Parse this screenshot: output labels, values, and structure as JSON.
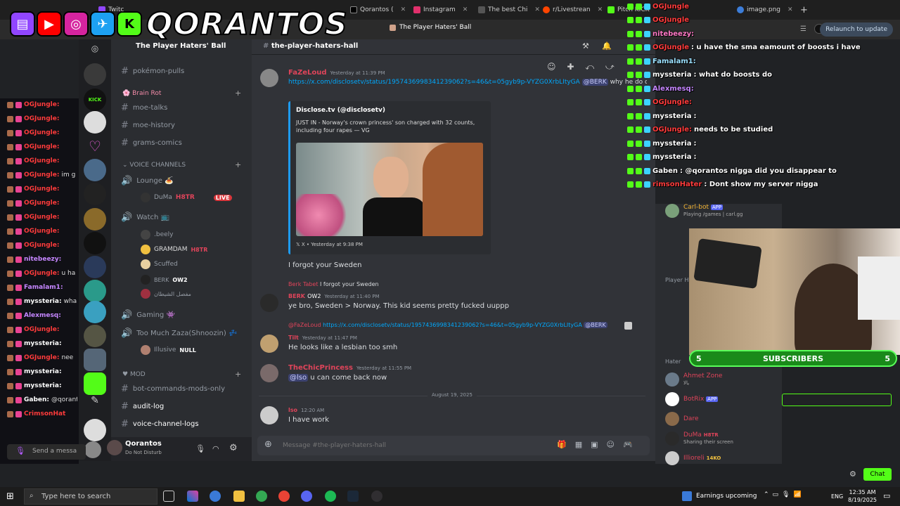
{
  "browser": {
    "tabs": [
      {
        "label": "Twitc",
        "color": "#9146ff"
      },
      {
        "label": "Qorantos (",
        "color": "#000000"
      },
      {
        "label": "Instagram",
        "color": "#e1306c"
      },
      {
        "label": "The best Chi",
        "color": "#444444"
      },
      {
        "label": "r/Livestrean",
        "color": "#ff4500"
      },
      {
        "label": "Pitch KICK",
        "color": "#53fc18"
      },
      {
        "label": "image.png",
        "color": "#3c7dd9"
      }
    ],
    "window_title": "The Player Haters' Ball",
    "relaunch_label": "Relaunch to update"
  },
  "overlay": {
    "brand": "QORANTOS"
  },
  "discord": {
    "server_name": "The Player Haters' Ball",
    "channel_name": "the-player-haters-hall",
    "channels_top": [
      "pokémon-pulls"
    ],
    "category_brainrot": "Brain Rot",
    "channels_brainrot": [
      "moe-talks",
      "moe-history",
      "grams-comics"
    ],
    "category_voice": "VOICE CHANNELS",
    "voice": [
      {
        "name": "Lounge 🍝",
        "users": [
          {
            "name": "DuMa",
            "tag": "H8TR",
            "live": "LIVE"
          }
        ]
      },
      {
        "name": "Watch 📺",
        "users": [
          {
            "name": ".beely"
          },
          {
            "name": "GRAMDAM",
            "tag": "H8TR"
          },
          {
            "name": "Scuffed"
          },
          {
            "name": "BERK",
            "tag": "OW2"
          },
          {
            "name": "مفصل الشيطان"
          }
        ]
      },
      {
        "name": "Gaming 👾",
        "users": []
      },
      {
        "name": "Too Much Zaza(Shnoozin) 💤",
        "users": [
          {
            "name": "Illusive",
            "tag": "NULL"
          }
        ]
      }
    ],
    "category_mod": "MOD",
    "channels_mod": [
      "bot-commands-mods-only",
      "audit-log",
      "voice-channel-logs"
    ],
    "self": {
      "name": "Qorantos",
      "status": "Do Not Disturb"
    },
    "messages": {
      "m1_name": "FaZeLoud",
      "m1_time": "Yesterday at 11:39 PM",
      "m1_link": "https://x.com/disclosetv/status/1957436998341239062?s=46&t=05gyb9p-VYZG0XrbLItyGA",
      "m1_mention": "@BERK",
      "m1_tail": "why he do dat",
      "embed_author": "Disclose.tv (@disclosetv)",
      "embed_text_1": "JUST IN - Norway's crown princess' son charged with 32 counts,",
      "embed_text_2": "including four rapes — VG",
      "embed_footer": "X • Yesterday at 9:38 PM",
      "m1_followup": "I forgot your Sweden",
      "m2_reply_name": "Berk Tabet",
      "m2_reply_text": "I forgot your Sweden",
      "m2_name": "BERK",
      "m2_tag": "OW2",
      "m2_time": "Yesterday at 11:40 PM",
      "m2_text": "ye bro, Sweden > Norway. This kid seems pretty fucked uuppp",
      "m3_reply_name": "@FaZeLoud",
      "m3_reply_link": "https://x.com/disclosetv/status/1957436998341239062?s=46&t=05gyb9p-VYZG0XrbLItyGA",
      "m3_reply_mention": "@BERK",
      "m3_name": "Tilt",
      "m3_time": "Yesterday at 11:47 PM",
      "m3_text": "He looks like a lesbian too smh",
      "m4_name": "TheChicPrincess",
      "m4_time": "Yesterday at 11:55 PM",
      "m4_mention": "@lso",
      "m4_text": "u can come back now",
      "date_divider": "August 19, 2025",
      "m5_name": "lso",
      "m5_time": "12:20 AM",
      "m5_text": "I have work"
    },
    "composer_placeholder": "Message #the-player-haters-hall",
    "member_groups": [
      "Player H",
      "Hater"
    ],
    "members_top": [
      {
        "name": "Carl-bot",
        "badge": "APP",
        "sub": "Playing /games | carl.gg",
        "color": "#f0b232"
      }
    ],
    "members_hater": [
      {
        "name": "Ahmet Zone",
        "sub": "يالا",
        "color": "#e0445a"
      },
      {
        "name": "BotRix",
        "badge": "APP",
        "sub": "",
        "color": "#e0445a"
      },
      {
        "name": "Dare",
        "sub": "",
        "color": "#e0445a"
      },
      {
        "name": "DuMa",
        "badge": "H8TR",
        "sub": "Sharing their screen",
        "color": "#e0445a"
      },
      {
        "name": "Illioreli",
        "badge": "14KO",
        "sub": "",
        "color": "#e0445a"
      }
    ]
  },
  "chat_left": {
    "rows": [
      {
        "name": "OGJungle:",
        "text": ""
      },
      {
        "name": "OGJungle:",
        "text": ""
      },
      {
        "name": "OGJungle:",
        "text": ""
      },
      {
        "name": "OGJungle:",
        "text": ""
      },
      {
        "name": "OGJungle:",
        "text": ""
      },
      {
        "name": "OGJungle:",
        "text": "im g"
      },
      {
        "name": "OGJungle:",
        "text": ""
      },
      {
        "name": "OGJungle:",
        "text": ""
      },
      {
        "name": "OGJungle:",
        "text": ""
      },
      {
        "name": "OGJungle:",
        "text": ""
      },
      {
        "name": "OGJungle:",
        "text": ""
      },
      {
        "name": "nitebeezy:",
        "text": ""
      },
      {
        "name": "OGJungle:",
        "text": "u ha"
      },
      {
        "name": "Famalam1:",
        "text": ""
      },
      {
        "name": "myssteria:",
        "text": "wha"
      },
      {
        "name": "Alexmesq:",
        "text": ""
      },
      {
        "name": "OGJungle:",
        "text": ""
      },
      {
        "name": "myssteria:",
        "text": ""
      },
      {
        "name": "OGJungle:",
        "text": "nee"
      },
      {
        "name": "myssteria:",
        "text": ""
      },
      {
        "name": "myssteria:",
        "text": ""
      },
      {
        "name": "Gaben:",
        "text": "@qorantos"
      },
      {
        "name": "CrimsonHat",
        "text": ""
      }
    ],
    "send_placeholder": "Send a messa"
  },
  "chat_right": {
    "rows": [
      {
        "name": "OGJungle",
        "text": "",
        "color": "#ff3b3b"
      },
      {
        "name": "OGJungle",
        "text": "",
        "color": "#ff3b3b"
      },
      {
        "name": "nitebeezy:",
        "text": "",
        "color": "#ff79c6"
      },
      {
        "name": "OGJungle",
        "text": ": u have the sma eamount of boosts i have",
        "color": "#ff3b3b"
      },
      {
        "name": "Famalam1:",
        "text": "",
        "color": "#9be0ff"
      },
      {
        "name": "myssteria",
        "text": ": what do boosts do",
        "color": "#ffffff"
      },
      {
        "name": "Alexmesq:",
        "text": "",
        "color": "#c586ff"
      },
      {
        "name": "OGJungle:",
        "text": "",
        "color": "#ff3b3b"
      },
      {
        "name": "myssteria",
        "text": ":",
        "color": "#ffffff"
      },
      {
        "name": "OGJungle:",
        "text": " needs to be studied",
        "color": "#ff3b3b"
      },
      {
        "name": "myssteria",
        "text": ":",
        "color": "#ffffff"
      },
      {
        "name": "myssteria",
        "text": ":",
        "color": "#ffffff"
      },
      {
        "name": "Gaben",
        "text": ": @qorantos nigga            did you disappear to",
        "color": "#ffffff"
      },
      {
        "name": "rimsonHater",
        "text": ": Dont show my server nigga",
        "color": "#ff3b3b"
      }
    ],
    "chat_button": "Chat"
  },
  "subs": {
    "left": "5",
    "label": "SUBSCRIBERS",
    "right": "5"
  },
  "taskbar": {
    "search_placeholder": "Type here to search",
    "weather": "Earnings upcoming",
    "lang": "ENG",
    "time": "12:35 AM",
    "date": "8/19/2025"
  }
}
